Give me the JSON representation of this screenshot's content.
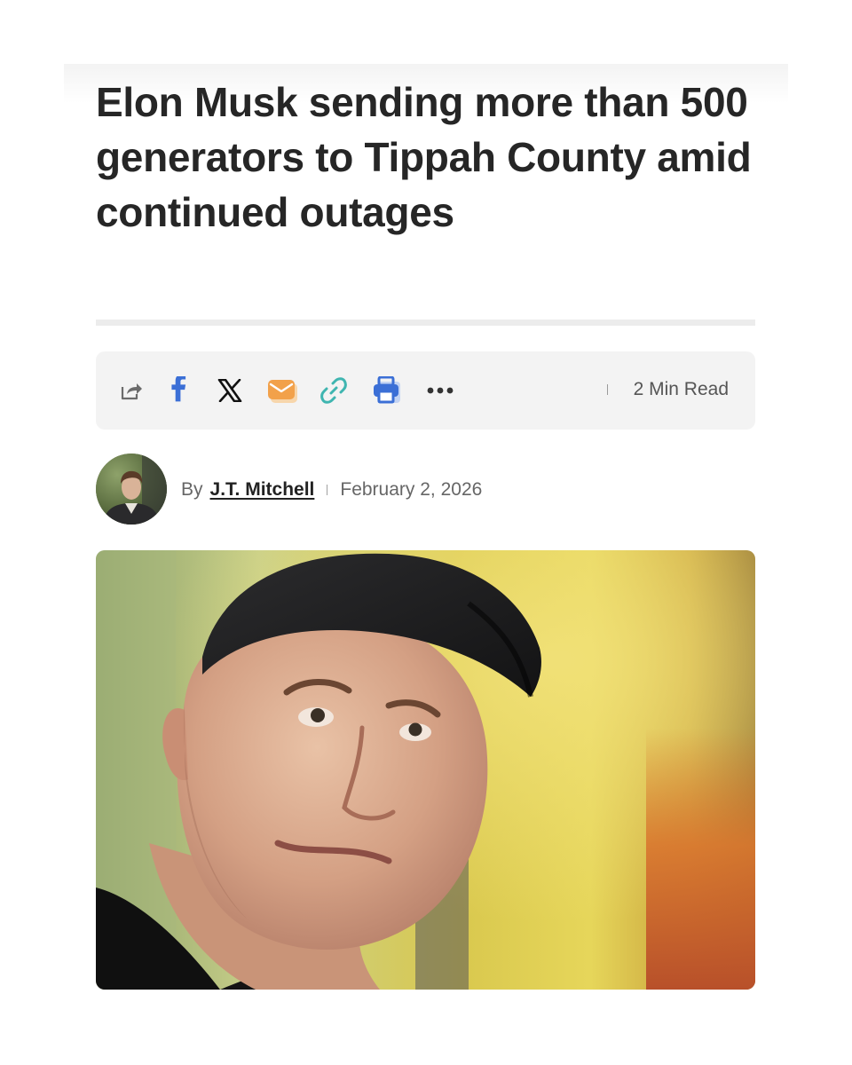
{
  "article": {
    "headline": "Elon Musk sending more than 500 generators to Tippah County amid continued outages"
  },
  "share_bar": {
    "icons": [
      {
        "name": "share-icon",
        "color": "#6b6b6b"
      },
      {
        "name": "facebook-icon",
        "color": "#3b6fd6"
      },
      {
        "name": "x-icon",
        "color": "#111111"
      },
      {
        "name": "email-icon",
        "color": "#f2a14a"
      },
      {
        "name": "link-icon",
        "color": "#3fb5b0"
      },
      {
        "name": "print-icon",
        "color": "#3b6fd6"
      },
      {
        "name": "more-icon",
        "color": "#333333"
      }
    ],
    "read_time": "2 Min Read"
  },
  "byline": {
    "prefix": "By",
    "author": "J.T. Mitchell",
    "date": "February 2, 2026"
  },
  "colors": {
    "headline": "#262626",
    "bar_background": "#f3f3f3",
    "rule": "#ececec"
  }
}
